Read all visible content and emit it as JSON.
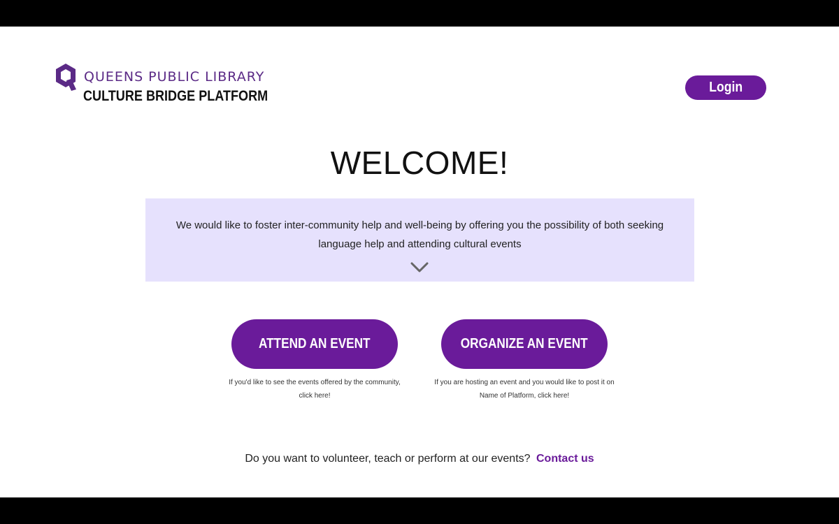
{
  "header": {
    "logo_line1": "QUEENS PUBLIC LIBRARY",
    "logo_line2": "CULTURE BRIDGE PLATFORM",
    "login_label": "Login"
  },
  "hero": {
    "title": "WELCOME!",
    "intro_text": "We would like to foster inter-community help and well-being by offering you the possibility of both seeking language help and attending cultural events"
  },
  "actions": {
    "attend_label": "ATTEND AN EVENT",
    "attend_caption": "If you'd like to see the events offered by the community, click here!",
    "organize_label": "ORGANIZE AN EVENT",
    "organize_caption": "If you are hosting an event and you would like to post it on Name of Platform, click here!"
  },
  "footer": {
    "question": "Do you want to volunteer, teach or perform at our events?",
    "contact_label": "Contact us"
  },
  "colors": {
    "brand_purple": "#6a1b9a",
    "logo_purple": "#5b2a86",
    "intro_bg": "#e6e1fd"
  },
  "icons": {
    "logo": "q-logo-icon",
    "expand": "chevron-down-icon"
  }
}
